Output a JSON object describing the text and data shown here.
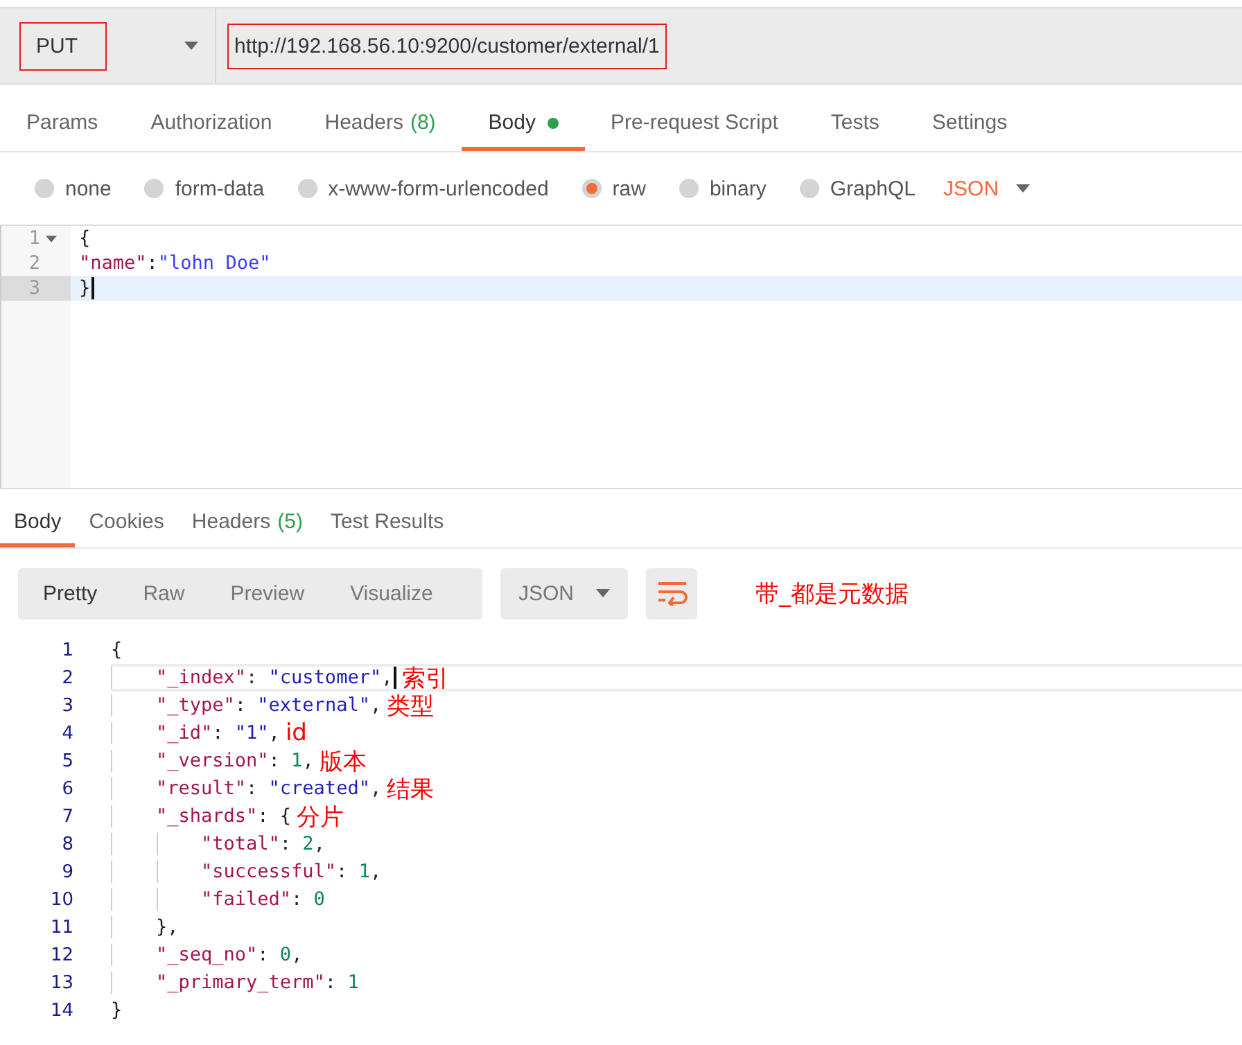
{
  "request": {
    "method": "PUT",
    "method_marked": true,
    "url": "http://192.168.56.10:9200/customer/external/1",
    "url_marked": true
  },
  "request_tabs": [
    {
      "label": "Params",
      "selected": false,
      "indicator": false
    },
    {
      "label": "Authorization",
      "selected": false,
      "indicator": false
    },
    {
      "label": "Headers",
      "count": "(8)",
      "selected": false,
      "indicator": false
    },
    {
      "label": "Body",
      "selected": true,
      "indicator": true
    },
    {
      "label": "Pre-request Script",
      "selected": false,
      "indicator": false
    },
    {
      "label": "Tests",
      "selected": false,
      "indicator": false
    },
    {
      "label": "Settings",
      "selected": false,
      "indicator": false
    }
  ],
  "body_types": [
    {
      "label": "none",
      "selected": false
    },
    {
      "label": "form-data",
      "selected": false
    },
    {
      "label": "x-www-form-urlencoded",
      "selected": false
    },
    {
      "label": "raw",
      "selected": true
    },
    {
      "label": "binary",
      "selected": false
    },
    {
      "label": "GraphQL",
      "selected": false
    }
  ],
  "body_format": "JSON",
  "request_body": {
    "lines": [
      {
        "number": "1",
        "foldable": true,
        "active": false,
        "tokens": [
          {
            "kind": "punct",
            "text": "{"
          }
        ]
      },
      {
        "number": "2",
        "foldable": false,
        "active": false,
        "tokens": [
          {
            "kind": "key",
            "text": "\"name\""
          },
          {
            "kind": "punct",
            "text": ":"
          },
          {
            "kind": "string",
            "text": "\"lohn Doe\""
          }
        ]
      },
      {
        "number": "3",
        "foldable": false,
        "active": true,
        "tokens": [
          {
            "kind": "punct",
            "text": "}"
          }
        ]
      }
    ]
  },
  "response_tabs": [
    {
      "label": "Body",
      "selected": true
    },
    {
      "label": "Cookies",
      "selected": false
    },
    {
      "label": "Headers",
      "count": "(5)",
      "selected": false
    },
    {
      "label": "Test Results",
      "selected": false
    }
  ],
  "view_modes": [
    {
      "label": "Pretty",
      "selected": true
    },
    {
      "label": "Raw",
      "selected": false
    },
    {
      "label": "Preview",
      "selected": false
    },
    {
      "label": "Visualize",
      "selected": false
    }
  ],
  "response_format": "JSON",
  "response_note": "带_都是元数据",
  "response_body": {
    "lines": [
      {
        "number": "1",
        "active": false,
        "tokens": [
          {
            "kind": "punct",
            "text": "{"
          }
        ],
        "children": [
          {
            "number": "2",
            "active": true,
            "tokens": [
              {
                "kind": "key",
                "text": "\"_index\""
              },
              {
                "kind": "punct",
                "text": ": "
              },
              {
                "kind": "string",
                "text": "\"customer\""
              },
              {
                "kind": "punct",
                "text": ","
              }
            ],
            "note": "索引"
          },
          {
            "number": "3",
            "active": false,
            "tokens": [
              {
                "kind": "key",
                "text": "\"_type\""
              },
              {
                "kind": "punct",
                "text": ": "
              },
              {
                "kind": "string",
                "text": "\"external\""
              },
              {
                "kind": "punct",
                "text": ","
              }
            ],
            "note": "类型"
          },
          {
            "number": "4",
            "active": false,
            "tokens": [
              {
                "kind": "key",
                "text": "\"_id\""
              },
              {
                "kind": "punct",
                "text": ": "
              },
              {
                "kind": "string",
                "text": "\"1\""
              },
              {
                "kind": "punct",
                "text": ","
              }
            ],
            "note": "id"
          },
          {
            "number": "5",
            "active": false,
            "tokens": [
              {
                "kind": "key",
                "text": "\"_version\""
              },
              {
                "kind": "punct",
                "text": ": "
              },
              {
                "kind": "number",
                "text": "1"
              },
              {
                "kind": "punct",
                "text": ","
              }
            ],
            "note": "版本"
          },
          {
            "number": "6",
            "active": false,
            "tokens": [
              {
                "kind": "key",
                "text": "\"result\""
              },
              {
                "kind": "punct",
                "text": ": "
              },
              {
                "kind": "string",
                "text": "\"created\""
              },
              {
                "kind": "punct",
                "text": ","
              }
            ],
            "note": "结果"
          },
          {
            "number": "7",
            "active": false,
            "tokens": [
              {
                "kind": "key",
                "text": "\"_shards\""
              },
              {
                "kind": "punct",
                "text": ": {"
              }
            ],
            "note": "分片",
            "children": [
              {
                "number": "8",
                "active": false,
                "tokens": [
                  {
                    "kind": "key",
                    "text": "\"total\""
                  },
                  {
                    "kind": "punct",
                    "text": ": "
                  },
                  {
                    "kind": "number",
                    "text": "2"
                  },
                  {
                    "kind": "punct",
                    "text": ","
                  }
                ]
              },
              {
                "number": "9",
                "active": false,
                "tokens": [
                  {
                    "kind": "key",
                    "text": "\"successful\""
                  },
                  {
                    "kind": "punct",
                    "text": ": "
                  },
                  {
                    "kind": "number",
                    "text": "1"
                  },
                  {
                    "kind": "punct",
                    "text": ","
                  }
                ]
              },
              {
                "number": "10",
                "active": false,
                "tokens": [
                  {
                    "kind": "key",
                    "text": "\"failed\""
                  },
                  {
                    "kind": "punct",
                    "text": ": "
                  },
                  {
                    "kind": "number",
                    "text": "0"
                  }
                ]
              }
            ]
          },
          {
            "number": "11",
            "active": false,
            "tokens": [
              {
                "kind": "punct",
                "text": "},"
              }
            ]
          },
          {
            "number": "12",
            "active": false,
            "tokens": [
              {
                "kind": "key",
                "text": "\"_seq_no\""
              },
              {
                "kind": "punct",
                "text": ": "
              },
              {
                "kind": "number",
                "text": "0"
              },
              {
                "kind": "punct",
                "text": ","
              }
            ]
          },
          {
            "number": "13",
            "active": false,
            "tokens": [
              {
                "kind": "key",
                "text": "\"_primary_term\""
              },
              {
                "kind": "punct",
                "text": ": "
              },
              {
                "kind": "number",
                "text": "1"
              }
            ]
          }
        ]
      },
      {
        "number": "14",
        "active": false,
        "tokens": [
          {
            "kind": "punct",
            "text": "}"
          }
        ]
      }
    ]
  }
}
